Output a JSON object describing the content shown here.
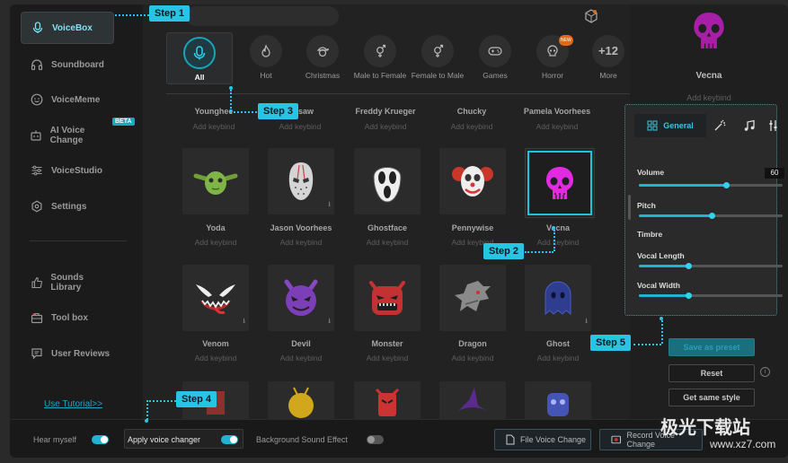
{
  "sidebar": {
    "items": [
      {
        "label": "VoiceBox",
        "icon": "microphone-icon",
        "active": true
      },
      {
        "label": "Soundboard",
        "icon": "headphones-icon",
        "active": false
      },
      {
        "label": "VoiceMeme",
        "icon": "smile-icon",
        "active": false
      },
      {
        "label": "AI Voice Change",
        "icon": "robot-icon",
        "active": false
      },
      {
        "label": "VoiceStudio",
        "icon": "sliders-icon",
        "active": false
      },
      {
        "label": "Settings",
        "icon": "gear-icon",
        "active": false
      },
      {
        "label": "Sounds Library",
        "icon": "thumbs-up-icon",
        "active": false
      },
      {
        "label": "Tool box",
        "icon": "toolbox-icon",
        "active": false
      },
      {
        "label": "User Reviews",
        "icon": "chat-icon",
        "active": false
      }
    ],
    "beta_badge": "BETA",
    "tutorial_link": "Use Tutorial>>"
  },
  "categories": [
    {
      "label": "All",
      "icon": "microphone-icon",
      "selected": true
    },
    {
      "label": "Hot",
      "icon": "flame-icon"
    },
    {
      "label": "Christmas",
      "icon": "santa-icon"
    },
    {
      "label": "Male to Female",
      "icon": "gender-icon"
    },
    {
      "label": "Female to Male",
      "icon": "gender-icon"
    },
    {
      "label": "Games",
      "icon": "gamepad-icon"
    },
    {
      "label": "Horror",
      "icon": "skull-icon",
      "badge": "NEW"
    },
    {
      "label": "More",
      "count": "+12"
    }
  ],
  "top_row": [
    {
      "name": "Younghee",
      "keybind": "Add keybind"
    },
    {
      "name": "Jigsaw",
      "keybind": "Add keybind"
    },
    {
      "name": "Freddy Krueger",
      "keybind": "Add keybind"
    },
    {
      "name": "Chucky",
      "keybind": "Add keybind"
    },
    {
      "name": "Pamela Voorhees",
      "keybind": "Add keybind"
    }
  ],
  "voices_row1": [
    {
      "name": "Yoda",
      "keybind": "Add keybind",
      "icon": "yoda-icon"
    },
    {
      "name": "Jason Voorhees",
      "keybind": "Add keybind",
      "icon": "hockey-mask-icon"
    },
    {
      "name": "Ghostface",
      "keybind": "Add keybind",
      "icon": "scream-mask-icon"
    },
    {
      "name": "Pennywise",
      "keybind": "Add keybind",
      "icon": "clown-icon"
    },
    {
      "name": "Vecna",
      "keybind": "Add keybind",
      "icon": "skull-icon",
      "selected": true
    }
  ],
  "voices_row2": [
    {
      "name": "Venom",
      "keybind": "Add keybind",
      "icon": "venom-icon"
    },
    {
      "name": "Devil",
      "keybind": "Add keybind",
      "icon": "devil-icon"
    },
    {
      "name": "Monster",
      "keybind": "Add keybind",
      "icon": "monster-icon"
    },
    {
      "name": "Dragon",
      "keybind": "Add keybind",
      "icon": "dragon-icon"
    },
    {
      "name": "Ghost",
      "keybind": "Add keybind",
      "icon": "ghost-icon"
    }
  ],
  "selected_voice": {
    "name": "Vecna",
    "keybind": "Add keybind"
  },
  "panel": {
    "tabs": [
      {
        "label": "General",
        "icon": "grid-icon",
        "active": true
      },
      {
        "icon": "magic-wand-icon"
      },
      {
        "icon": "music-note-icon"
      },
      {
        "icon": "equalizer-icon"
      }
    ],
    "volume_label": "Volume",
    "volume_value": "60",
    "pitch_label": "Pitch",
    "timbre_label": "Timbre",
    "vocal_length_label": "Vocal Length",
    "vocal_width_label": "Vocal Width"
  },
  "actions": {
    "save_preset": "Save as preset",
    "reset": "Reset",
    "same_style": "Get same style",
    "info": "i"
  },
  "bottom": {
    "hear_myself": "Hear myself",
    "apply_voice_changer": "Apply voice changer",
    "background_sound": "Background Sound Effect",
    "file_voice_change": "File Voice Change",
    "record_voice_change": "Record Voice Change"
  },
  "steps": {
    "s1": "Step 1",
    "s2": "Step 2",
    "s3": "Step 3",
    "s4": "Step 4",
    "s5": "Step 5"
  },
  "watermark": {
    "line1": "极光下载站",
    "line2": "www.xz7.com"
  },
  "colors": {
    "accent": "#1fb5d0",
    "step": "#27c4e4",
    "vecna": "#d61fd6"
  }
}
